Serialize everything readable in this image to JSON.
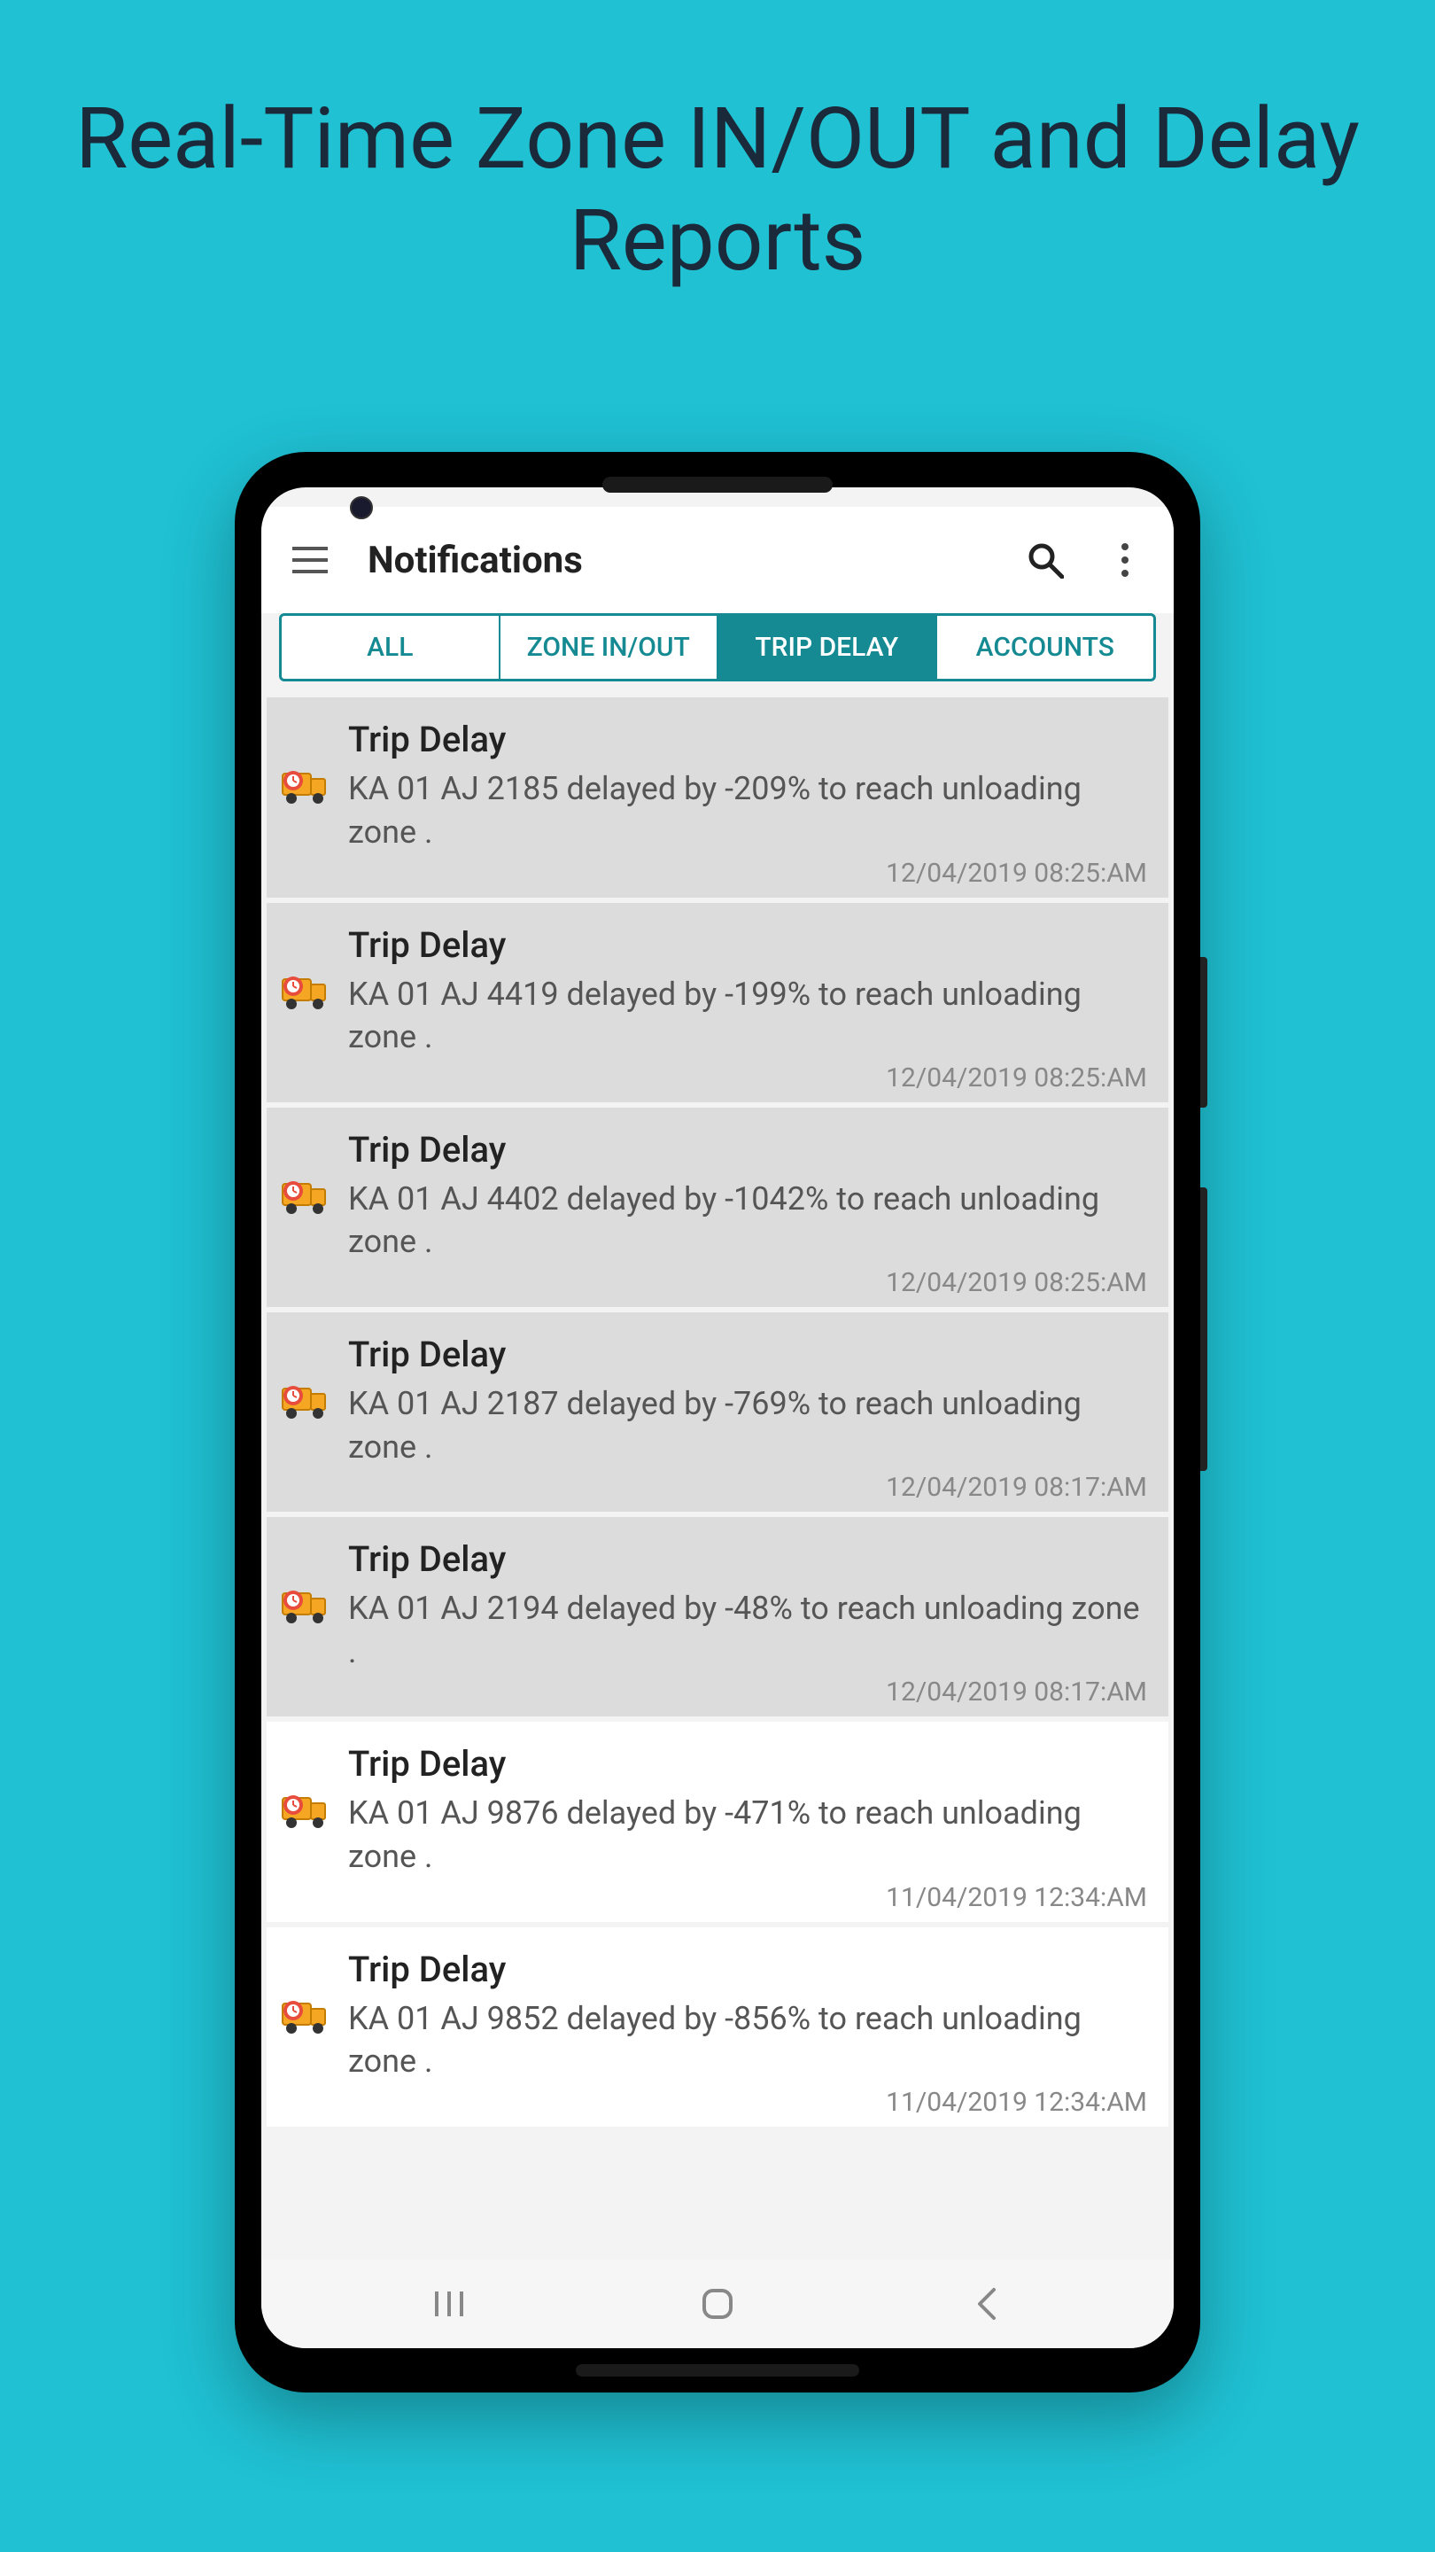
{
  "promo": {
    "title": "Real-Time Zone IN/OUT and Delay Reports"
  },
  "toolbar": {
    "title": "Notifications"
  },
  "tabs": [
    {
      "label": "ALL",
      "active": false
    },
    {
      "label": "ZONE IN/OUT",
      "active": false
    },
    {
      "label": "TRIP DELAY",
      "active": true
    },
    {
      "label": "ACCOUNTS",
      "active": false
    }
  ],
  "notifications": [
    {
      "title": "Trip Delay",
      "desc": "KA 01 AJ 2185 delayed by -209% to reach unloading zone .",
      "time": "12/04/2019 08:25:AM",
      "unread": true
    },
    {
      "title": "Trip Delay",
      "desc": "KA 01 AJ 4419 delayed by -199% to reach unloading zone .",
      "time": "12/04/2019 08:25:AM",
      "unread": true
    },
    {
      "title": "Trip Delay",
      "desc": "KA 01 AJ 4402 delayed by -1042% to reach unloading zone .",
      "time": "12/04/2019 08:25:AM",
      "unread": true
    },
    {
      "title": "Trip Delay",
      "desc": "KA 01 AJ 2187 delayed by -769% to reach unloading zone .",
      "time": "12/04/2019 08:17:AM",
      "unread": true
    },
    {
      "title": "Trip Delay",
      "desc": "KA 01 AJ 2194 delayed by -48% to reach unloading zone .",
      "time": "12/04/2019 08:17:AM",
      "unread": true
    },
    {
      "title": "Trip Delay",
      "desc": "KA 01 AJ 9876 delayed by -471% to reach unloading zone .",
      "time": "11/04/2019 12:34:AM",
      "unread": false
    },
    {
      "title": "Trip Delay",
      "desc": "KA 01 AJ 9852 delayed by -856% to reach unloading zone .",
      "time": "11/04/2019 12:34:AM",
      "unread": false
    }
  ],
  "colors": {
    "teal": "#158a93",
    "bg": "#1fc1d3"
  }
}
